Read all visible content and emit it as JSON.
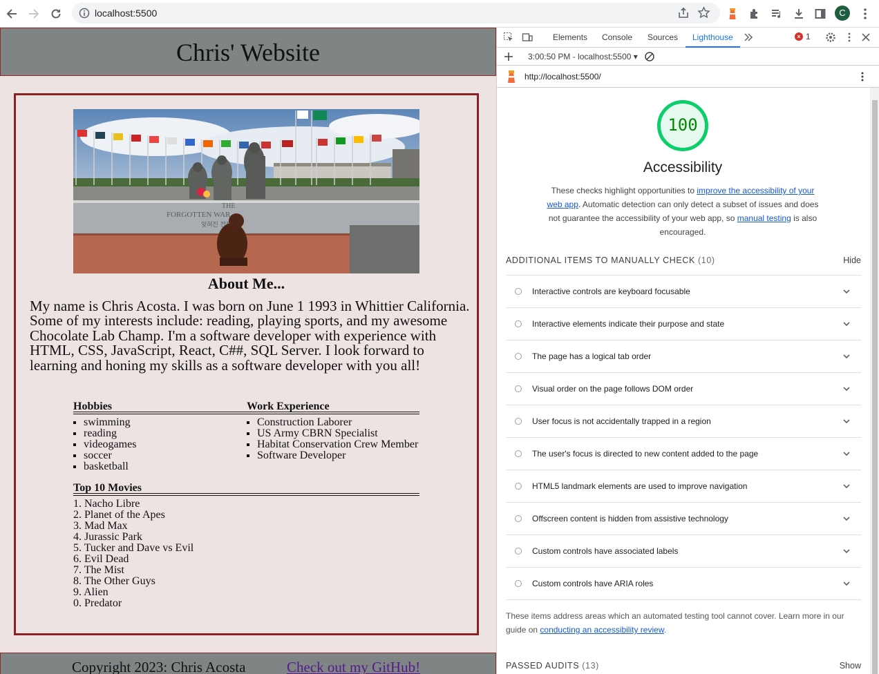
{
  "browser": {
    "url": "localhost:5500",
    "avatar_letter": "C"
  },
  "site": {
    "title": "Chris' Website",
    "about_title": "About Me...",
    "about_text": "My name is Chris Acosta. I was born on June 1 1993 in Whittier California. Some of my interests include: reading, playing sports, and my awesome Chocolate Lab Champ. I'm a software developer with experience with HTML, CSS, JavaScript, React, C##, SQL Server. I look forward to learning and honing my skills as a software developer with you all!",
    "hobbies_title": "Hobbies",
    "hobbies": [
      "swimming",
      "reading",
      "videogames",
      "soccer",
      "basketball"
    ],
    "work_title": "Work Experience",
    "work": [
      "Construction Laborer",
      "US Army CBRN Specialist",
      "Habitat Conservation Crew Member",
      "Software Developer"
    ],
    "movies_title": "Top 10 Movies",
    "movies": [
      "1. Nacho Libre",
      "2. Planet of the Apes",
      "3. Mad Max",
      "4. Jurassic Park",
      "5. Tucker and Dave vs Evil",
      "6. Evil Dead",
      "7. The Mist",
      "8. The Other Guys",
      "9. Alien",
      "0. Predator"
    ],
    "footer_copy": "Copyright 2023: Chris Acosta",
    "footer_link": "Check out my GitHub!"
  },
  "devtools": {
    "tabs": [
      "Elements",
      "Console",
      "Sources",
      "Lighthouse"
    ],
    "active_tab": "Lighthouse",
    "error_count": "1",
    "report_selector": "3:00:50 PM - localhost:5500",
    "report_url": "http://localhost:5500/",
    "score": "100",
    "category": "Accessibility",
    "desc_before": "These checks highlight opportunities to ",
    "desc_link1": "improve the accessibility of your web app",
    "desc_middle": ". Automatic detection can only detect a subset of issues and does not guarantee the accessibility of your web app, so ",
    "desc_link2": "manual testing",
    "desc_after": " is also encouraged.",
    "manual_group_title": "ADDITIONAL ITEMS TO MANUALLY CHECK",
    "manual_group_count": "(10)",
    "manual_group_toggle": "Hide",
    "audits": [
      "Interactive controls are keyboard focusable",
      "Interactive elements indicate their purpose and state",
      "The page has a logical tab order",
      "Visual order on the page follows DOM order",
      "User focus is not accidentally trapped in a region",
      "The user's focus is directed to new content added to the page",
      "HTML5 landmark elements are used to improve navigation",
      "Offscreen content is hidden from assistive technology",
      "Custom controls have associated labels",
      "Custom controls have ARIA roles"
    ],
    "manual_note_before": "These items address areas which an automated testing tool cannot cover. Learn more in our guide on ",
    "manual_note_link": "conducting an accessibility review",
    "manual_note_after": ".",
    "passed_title": "PASSED AUDITS",
    "passed_count": "(13)",
    "passed_toggle": "Show"
  },
  "colors": {
    "accent": "#1a73e8",
    "score_green": "#0cce6b",
    "page_bg": "#ede3e3",
    "header_bg": "#7f8585",
    "border_red": "#8b2020"
  }
}
